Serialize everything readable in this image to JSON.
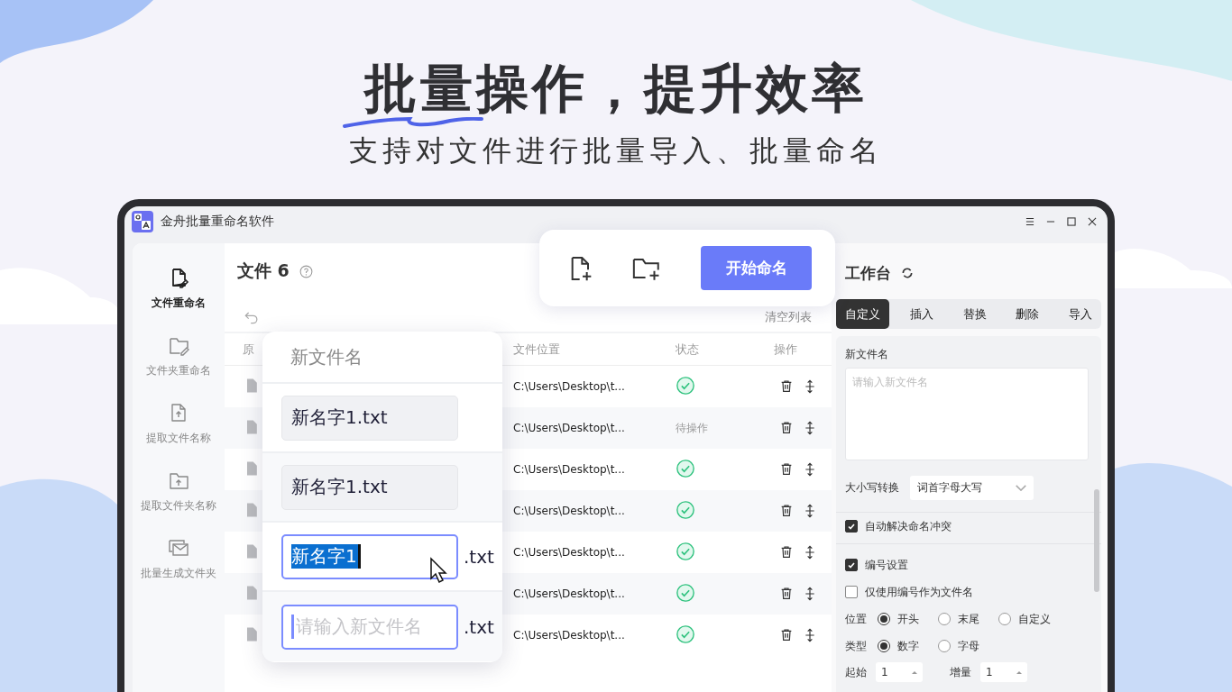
{
  "hero": {
    "title": "批量操作，提升效率",
    "subtitle": "支持对文件进行批量导入、批量命名"
  },
  "window": {
    "title": "金舟批量重命名软件"
  },
  "sidebar": {
    "items": [
      {
        "label": "文件重命名",
        "selected": true
      },
      {
        "label": "文件夹重命名",
        "selected": false
      },
      {
        "label": "提取文件名称",
        "selected": false
      },
      {
        "label": "提取文件夹名称",
        "selected": false
      },
      {
        "label": "批量生成文件夹",
        "selected": false
      }
    ]
  },
  "files": {
    "title": "文件 6",
    "clear_button": "清空列表",
    "columns": [
      "原",
      "文件位置",
      "状态",
      "操作"
    ],
    "rows": [
      {
        "location": "C:\\Users\\Desktop\\t...",
        "kind": "done"
      },
      {
        "location": "C:\\Users\\Desktop\\t...",
        "kind": "pending",
        "status_text": "待操作"
      },
      {
        "location": "C:\\Users\\Desktop\\t...",
        "kind": "done"
      },
      {
        "location": "C:\\Users\\Desktop\\t...",
        "kind": "done"
      },
      {
        "location": "C:\\Users\\Desktop\\t...",
        "kind": "done"
      },
      {
        "location": "C:\\Users\\Desktop\\t...",
        "kind": "done"
      },
      {
        "location": "C:\\Users\\Desktop\\t...",
        "kind": "done"
      }
    ]
  },
  "toolbar": {
    "start_button": "开始命名"
  },
  "rename_popup": {
    "header": "新文件名",
    "rows": [
      {
        "kind": "filled",
        "value": "新名字1.txt"
      },
      {
        "kind": "filled",
        "value": "新名字1.txt"
      },
      {
        "kind": "editing",
        "value": "新名字1",
        "suffix": ".txt"
      },
      {
        "kind": "empty",
        "placeholder": "请输入新文件名",
        "suffix": ".txt"
      }
    ]
  },
  "workbench": {
    "title": "工作台",
    "tabs": [
      {
        "label": "自定义",
        "selected": true
      },
      {
        "label": "插入",
        "selected": false
      },
      {
        "label": "替换",
        "selected": false
      },
      {
        "label": "删除",
        "selected": false
      },
      {
        "label": "导入",
        "selected": false
      }
    ],
    "new_name_label": "新文件名",
    "new_name_placeholder": "请输入新文件名",
    "case_label": "大小写转换",
    "case_value": "词首字母大写",
    "auto_resolve": {
      "label": "自动解决命名冲突",
      "checked": true
    },
    "numbering": {
      "label": "编号设置",
      "checked": true
    },
    "number_only": {
      "label": "仅使用编号作为文件名",
      "checked": false
    },
    "radio_groups": [
      {
        "label": "位置",
        "options": [
          {
            "label": "开头",
            "selected": true
          },
          {
            "label": "末尾",
            "selected": false
          },
          {
            "label": "自定义",
            "selected": false
          }
        ]
      },
      {
        "label": "类型",
        "options": [
          {
            "label": "数字",
            "selected": true
          },
          {
            "label": "字母",
            "selected": false
          }
        ]
      }
    ],
    "spinners": [
      {
        "label": "起始",
        "value": "1"
      },
      {
        "label": "增量",
        "value": "1"
      }
    ]
  }
}
